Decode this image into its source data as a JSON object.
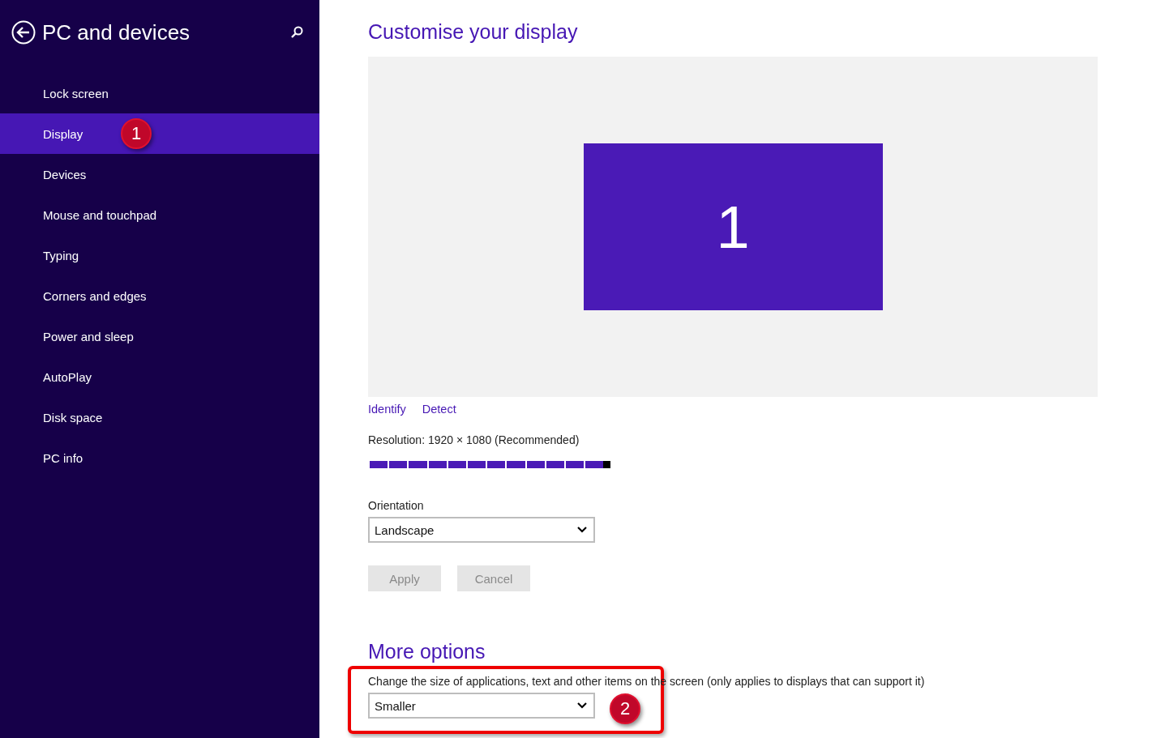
{
  "sidebar": {
    "title": "PC and devices",
    "items": [
      {
        "label": "Lock screen",
        "selected": false
      },
      {
        "label": "Display",
        "selected": true
      },
      {
        "label": "Devices",
        "selected": false
      },
      {
        "label": "Mouse and touchpad",
        "selected": false
      },
      {
        "label": "Typing",
        "selected": false
      },
      {
        "label": "Corners and edges",
        "selected": false
      },
      {
        "label": "Power and sleep",
        "selected": false
      },
      {
        "label": "AutoPlay",
        "selected": false
      },
      {
        "label": "Disk space",
        "selected": false
      },
      {
        "label": "PC info",
        "selected": false
      }
    ]
  },
  "content": {
    "title": "Customise your display",
    "monitor_number": "1",
    "links": [
      "Identify",
      "Detect"
    ],
    "resolution": {
      "label": "Resolution: 1920 × 1080 (Recommended)",
      "level": 1
    },
    "orientation": {
      "label": "Orientation",
      "value": "Landscape"
    },
    "buttons": [
      {
        "label": "Apply",
        "disabled": true
      },
      {
        "label": "Cancel",
        "disabled": true
      }
    ],
    "more_options": {
      "title": "More options",
      "label": "Change the size of applications, text and other items on the screen (only applies to displays that can support it)",
      "value": "Smaller"
    }
  },
  "annotations": [
    {
      "number": "1"
    },
    {
      "number": "2"
    }
  ]
}
